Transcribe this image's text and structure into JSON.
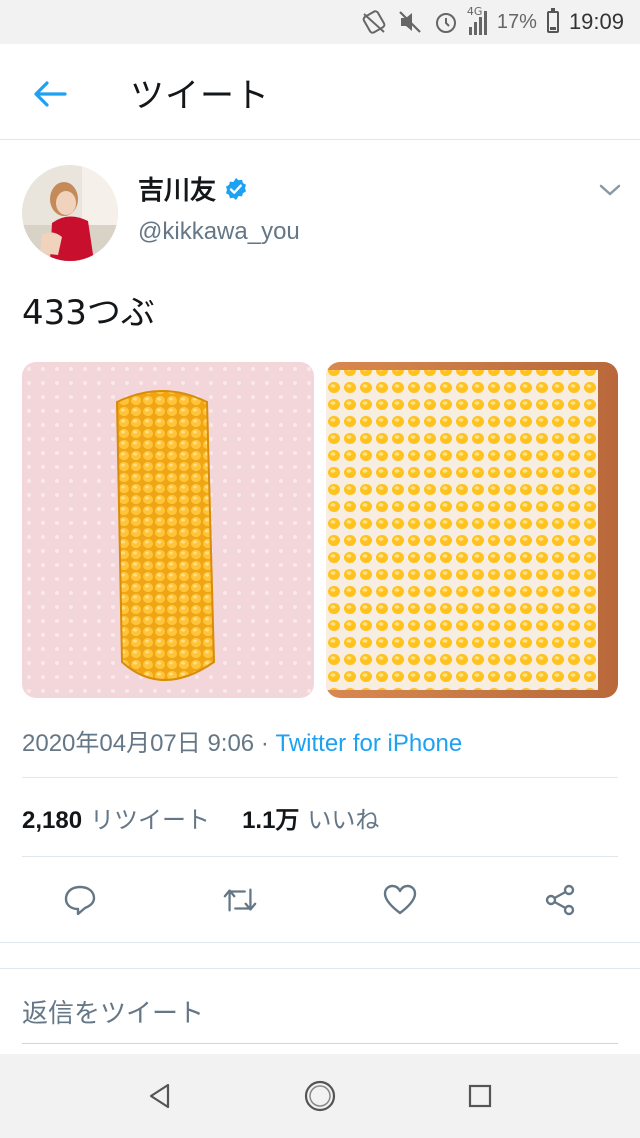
{
  "status_bar": {
    "network": "4G",
    "battery": "17%",
    "battery_level": 0.17,
    "time": "19:09"
  },
  "header": {
    "title": "ツイート"
  },
  "tweet": {
    "author_name": "吉川友",
    "author_handle": "@kikkawa_you",
    "verified": true,
    "text": "433つぶ",
    "date": "2020年04月07日 9:06",
    "separator": " · ",
    "source": "Twitter for iPhone",
    "retweet_count": "2,180",
    "retweet_label": "リツイート",
    "like_count": "1.1万",
    "like_label": "いいね"
  },
  "reply": {
    "placeholder": "返信をツイート"
  },
  "colors": {
    "accent": "#1da1f2",
    "text_primary": "#14171a",
    "text_secondary": "#657786",
    "divider": "#e1e8ed"
  },
  "icons": {
    "back": "arrow-left-icon",
    "verified": "verified-badge-icon",
    "more": "chevron-down-icon",
    "reply": "comment-icon",
    "retweet": "retweet-icon",
    "like": "heart-icon",
    "share": "share-icon"
  }
}
